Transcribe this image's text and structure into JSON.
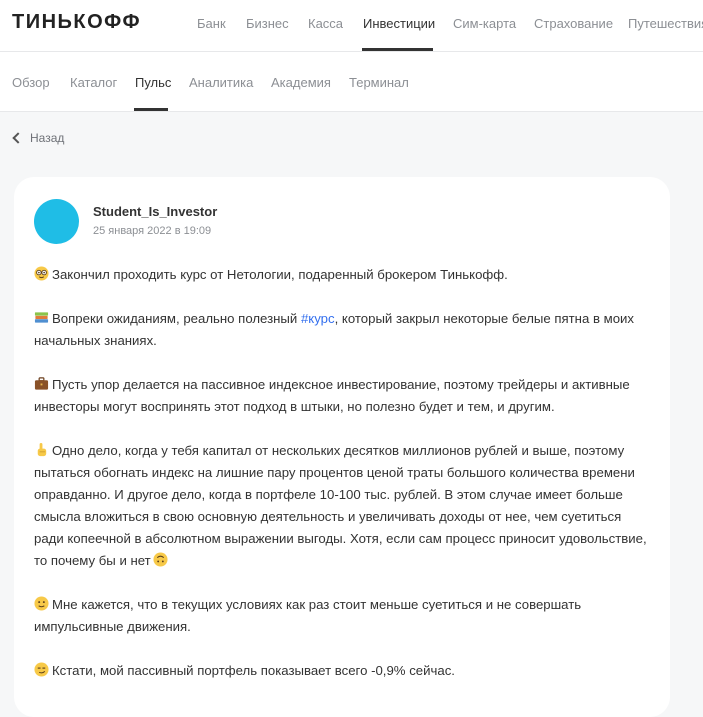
{
  "brand": {
    "logo": "ТИНЬКОФФ"
  },
  "main_nav": {
    "items": [
      {
        "label": "Банк"
      },
      {
        "label": "Бизнес"
      },
      {
        "label": "Касса"
      },
      {
        "label": "Инвестиции",
        "active": true
      },
      {
        "label": "Сим-карта"
      },
      {
        "label": "Страхование"
      },
      {
        "label": "Путешествия"
      }
    ]
  },
  "sub_nav": {
    "items": [
      {
        "label": "Обзор"
      },
      {
        "label": "Каталог"
      },
      {
        "label": "Пульс",
        "active": true
      },
      {
        "label": "Аналитика"
      },
      {
        "label": "Академия"
      },
      {
        "label": "Терминал"
      }
    ]
  },
  "back": {
    "label": "Назад",
    "icon": "chevron-left-icon"
  },
  "post": {
    "author": "Student_Is_Investor",
    "date": "25 января 2022 в 19:09",
    "avatar_color": "#1fbde6",
    "hashtag_color": "#336fee",
    "paragraphs": {
      "p1": {
        "icon": "nerd-face-emoji",
        "text": "Закончил проходить курс от Нетологии, подаренный брокером Тинькофф."
      },
      "p2": {
        "icon": "books-emoji",
        "before": "Вопреки ожиданиям, реально полезный ",
        "tag": "#курс",
        "after": ", который закрыл некоторые белые пятна в моих начальных знаниях."
      },
      "p3": {
        "icon": "briefcase-emoji",
        "text": "Пусть упор делается на пассивное индексное инвестирование, поэтому трейдеры и активные инвесторы могут воспринять этот подход в штыки, но полезно будет и тем, и другим."
      },
      "p4": {
        "icon": "pointing-up-emoji",
        "text": "Одно дело, когда у тебя капитал от нескольких десятков миллионов рублей и выше, поэтому пытаться обогнать индекс на лишние пару процентов ценой траты большого количества времени оправданно. И другое дело, когда в портфеле 10-100 тыс. рублей. В этом случае имеет больше смысла вложиться в свою основную деятельность и увеличивать доходы от нее, чем суетиться ради копеечной в абсолютном выражении выгоды. Хотя, если сам процесс приносит удовольствие, то почему бы и нет",
        "end_icon": "upside-down-face-emoji"
      },
      "p5": {
        "icon": "neutral-face-emoji",
        "text": "Мне кажется, что в текущих условиях как раз стоит меньше суетиться и не совершать импульсивные движения."
      },
      "p6": {
        "icon": "smirk-face-emoji",
        "text": "Кстати, мой пассивный портфель показывает всего -0,9% сейчас."
      }
    }
  }
}
